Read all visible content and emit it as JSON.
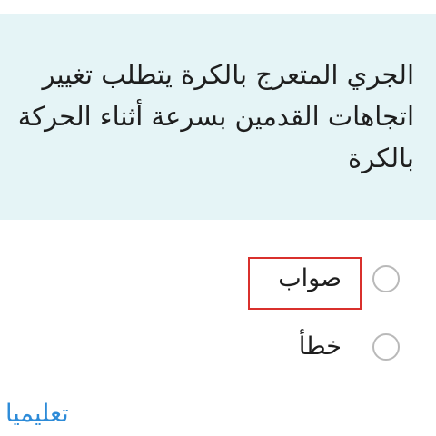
{
  "question": {
    "text": "الجري المتعرج بالكرة يتطلب تغيير اتجاهات القدمين بسرعة أثناء الحركة بالكرة"
  },
  "options": [
    {
      "label": "صواب",
      "selected": false,
      "highlighted": true
    },
    {
      "label": "خطأ",
      "selected": false,
      "highlighted": false
    }
  ],
  "watermark": {
    "text": "تعليميا"
  },
  "colors": {
    "question_background": "#e5f4f6",
    "highlight_border": "#d9302c",
    "watermark": "#2d8bd8",
    "radio_border": "#b9b9b9"
  }
}
